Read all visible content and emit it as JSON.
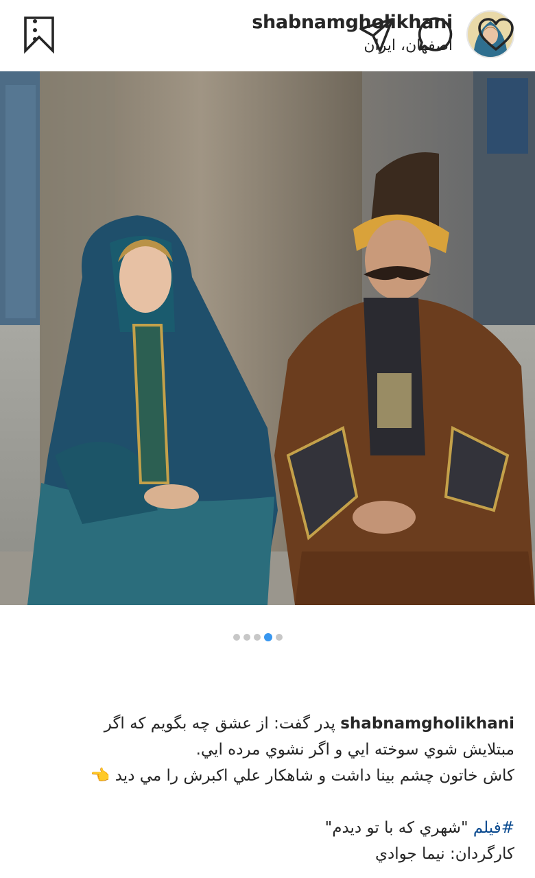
{
  "post": {
    "username": "shabnamgholikhani",
    "location": "اصفهان، ایران",
    "more_icon": "more-vertical-icon"
  },
  "actions": {
    "like_icon": "heart-icon",
    "comment_icon": "comment-icon",
    "share_icon": "send-icon",
    "save_icon": "bookmark-icon",
    "carousel": {
      "count": 5,
      "active_index": 3
    }
  },
  "caption": {
    "username": "shabnamgholikhani",
    "line1": "پدر گفت: از عشق چه بگويم كه اگر",
    "line2": "مبتلايش شوي سوخته ايي و اگر نشوي مرده ايي.",
    "line3": "كاش خاتون چشم بينا داشت و شاهكار علي اكبرش را مي ديد",
    "line3_emoji": "👈",
    "hashtag": "#فيلم",
    "film_title": "\"شهري كه با تو ديدم\"",
    "director_line": "كارگردان: نيما جوادي"
  },
  "colors": {
    "text": "#262626",
    "hashtag": "#0a4a8f",
    "dot_active": "#3897f0",
    "dot_inactive": "#c7c7c7"
  }
}
